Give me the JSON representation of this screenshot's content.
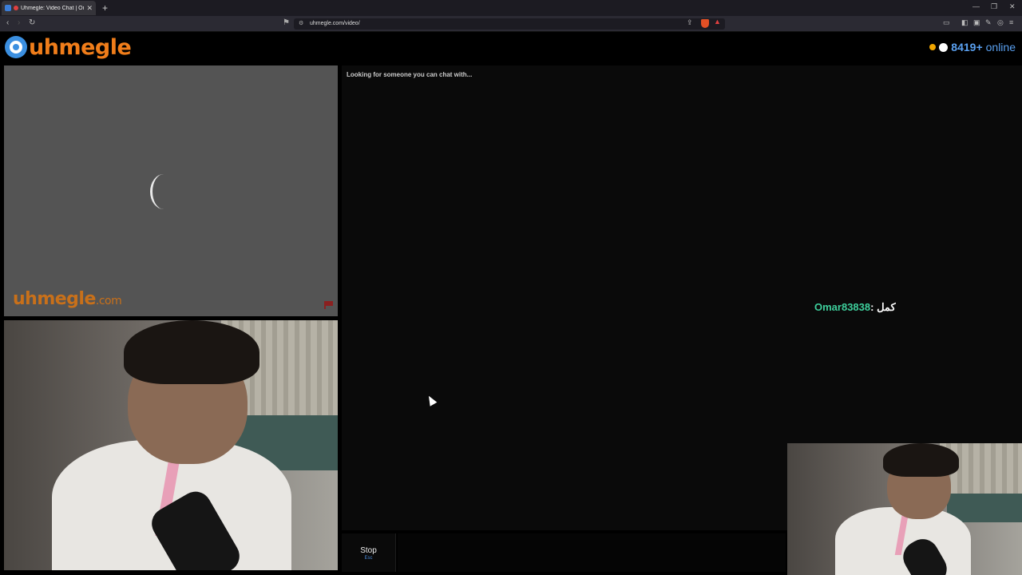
{
  "browser": {
    "tab_title": "Uhmegle: Video Chat | Omeg",
    "url": "uhmegle.com/video/"
  },
  "site": {
    "logo_text": "uhmegle",
    "online_count": "8419+",
    "online_label": "online"
  },
  "video": {
    "watermark_text": "uhmegle",
    "watermark_suffix": ".com"
  },
  "chat": {
    "status_text": "Looking for someone you can chat with...",
    "messages": [
      {
        "user": "Omar83838",
        "text": "كمل"
      }
    ]
  },
  "controls": {
    "stop_label": "Stop",
    "stop_shortcut": "Esc"
  },
  "colors": {
    "brand_orange": "#f07d1a",
    "brand_blue": "#3b8fe0",
    "online_blue": "#5aa0f0",
    "username_green": "#3ecf9c"
  }
}
